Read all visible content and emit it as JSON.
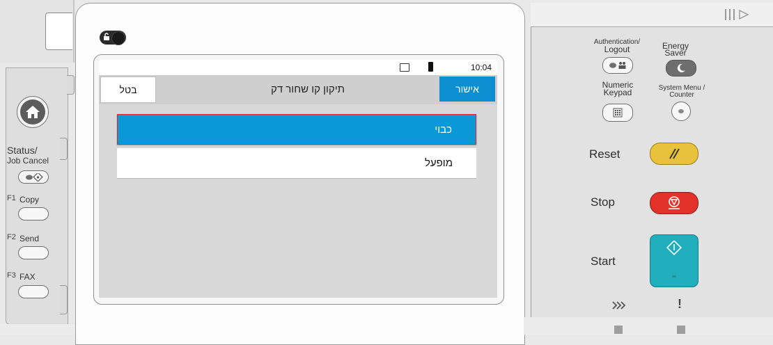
{
  "left_panel": {
    "status_label_1": "Status/",
    "status_label_2": "Job Cancel",
    "f1_key": "F1",
    "f1_label": "Copy",
    "f2_key": "F2",
    "f2_label": "Send",
    "f3_key": "F3",
    "f3_label": "FAX"
  },
  "screen": {
    "clock": "10:04",
    "title": "תיקון קו שחור דק",
    "cancel_label": "בטל",
    "ok_label": "אישור",
    "options": [
      {
        "label": "כבוי",
        "selected": true
      },
      {
        "label": "מופעל",
        "selected": false
      }
    ]
  },
  "right_panel": {
    "auth_label_1": "Authentication/",
    "auth_label_2": "Logout",
    "energy_label_1": "Energy",
    "energy_label_2": "Saver",
    "numeric_label_1": "Numeric",
    "numeric_label_2": "Keypad",
    "system_label_1": "System Menu /",
    "system_label_2": "Counter",
    "reset_label": "Reset",
    "stop_label": "Stop",
    "start_label": "Start",
    "exclaim": "!"
  },
  "colors": {
    "selected_option": "#0b98d6",
    "ok_button": "#0b8fd1",
    "reset_button": "#e8c23d",
    "stop_button": "#e2322a",
    "start_button": "#20aebd",
    "selection_border": "#e0242c"
  }
}
